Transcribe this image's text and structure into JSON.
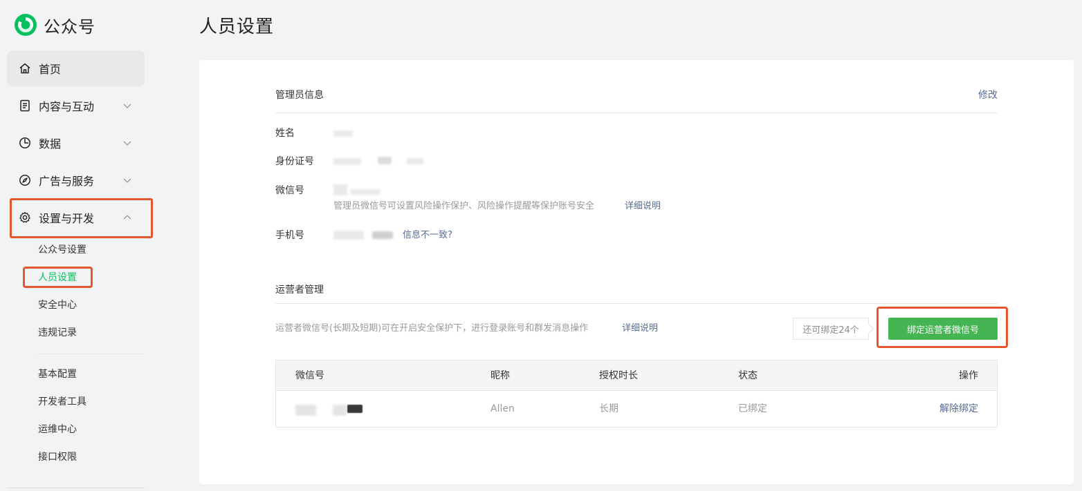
{
  "brand": {
    "name": "公众号",
    "logo_icon": "wechat-mp-logo-icon",
    "accent": "#07c160"
  },
  "sidebar": {
    "items": [
      {
        "label": "首页",
        "icon": "home-icon"
      },
      {
        "label": "内容与互动",
        "icon": "document-icon"
      },
      {
        "label": "数据",
        "icon": "pie-chart-icon"
      },
      {
        "label": "广告与服务",
        "icon": "compass-icon"
      },
      {
        "label": "设置与开发",
        "icon": "gear-icon"
      }
    ],
    "sub_items": [
      "公众号设置",
      "人员设置",
      "安全中心",
      "违规记录",
      "基本配置",
      "开发者工具",
      "运维中心",
      "接口权限"
    ]
  },
  "page": {
    "title": "人员设置"
  },
  "admin": {
    "section_title": "管理员信息",
    "edit_label": "修改",
    "fields": {
      "name_label": "姓名",
      "id_label": "身份证号",
      "wechat_label": "微信号",
      "wechat_hint": "管理员微信号可设置风险操作保护、风险操作提醒等保护账号安全",
      "wechat_hint_link": "详细说明",
      "phone_label": "手机号",
      "phone_link": "信息不一致?"
    }
  },
  "operators": {
    "section_title": "运营者管理",
    "description": "运营者微信号(长期及短期)可在开启安全保护下，进行登录账号和群发消息操作",
    "description_link": "详细说明",
    "remaining": "还可绑定24个",
    "bind_button": "绑定运营者微信号",
    "table": {
      "headers": [
        "微信号",
        "昵称",
        "授权时长",
        "状态",
        "操作"
      ],
      "rows": [
        {
          "nickname": "Allen",
          "duration": "长期",
          "status": "已绑定",
          "action": "解除绑定"
        }
      ]
    }
  },
  "colors": {
    "link": "#576b95",
    "button": "#45b553",
    "highlight": "#e4572e",
    "selected": "#07c160"
  }
}
